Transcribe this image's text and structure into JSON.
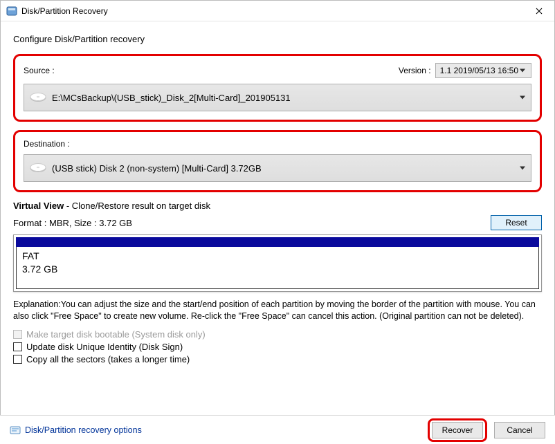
{
  "window": {
    "title": "Disk/Partition Recovery"
  },
  "heading": "Configure Disk/Partition recovery",
  "source": {
    "label": "Source :",
    "version_label": "Version :",
    "version_value": "1.1  2019/05/13 16:50",
    "path": "E:\\MCsBackup\\(USB_stick)_Disk_2[Multi-Card]_201905131"
  },
  "destination": {
    "label": "Destination :",
    "value": "(USB stick) Disk 2 (non-system) [Multi-Card]   3.72GB"
  },
  "virtual_view": {
    "title_bold": "Virtual View",
    "title_rest": " - Clone/Restore result on target disk",
    "format_line": "Format : MBR,  Size : 3.72 GB",
    "reset_label": "Reset",
    "partition_fs": "FAT",
    "partition_size": "3.72 GB"
  },
  "explanation": "Explanation:You can adjust the size and the start/end position of each partition by moving the border of the partition with mouse. You can also click \"Free Space\" to create new volume. Re-click the \"Free Space\" can cancel this action. (Original partition can not be deleted).",
  "checks": {
    "bootable": "Make target disk bootable (System disk only)",
    "unique_id": "Update disk Unique Identity (Disk Sign)",
    "copy_all": "Copy all the sectors (takes a longer time)"
  },
  "footer": {
    "options_link": "Disk/Partition recovery options",
    "recover": "Recover",
    "cancel": "Cancel"
  }
}
